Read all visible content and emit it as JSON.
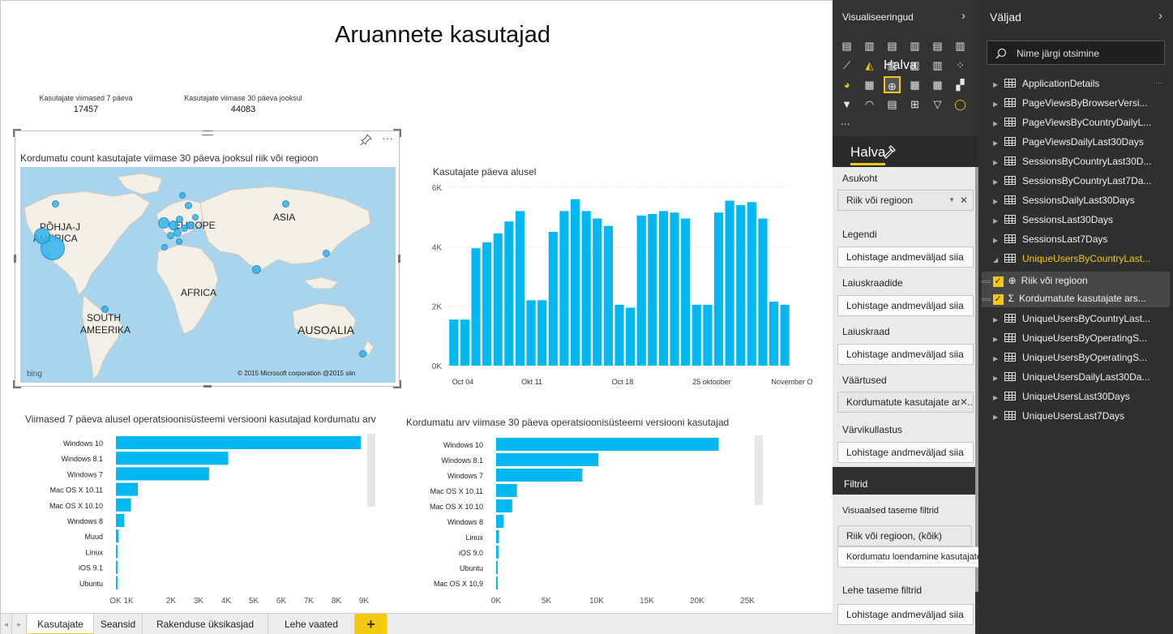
{
  "report": {
    "title": "Aruannete kasutajad",
    "cards": [
      {
        "label": "Kasutajate viimased 7 päeva",
        "value": "17457"
      },
      {
        "label": "Kasutajate viimase 30 päeva jooksul",
        "value": "44083"
      }
    ]
  },
  "map": {
    "title": "Kordumatu count kasutajate viimase 30 päeva jooksul riik või regioon",
    "labels": {
      "north_america_1": "PÕHJA-J",
      "north_america_2": "AMERICA",
      "europe": "EUROPE",
      "asia": "ASIA",
      "africa": "AFRICA",
      "south_america_1": "SOUTH",
      "south_america_2": "AMEERIKA",
      "australia": "AUSOALIA"
    },
    "copyright": "© 2015 Microsoft corporation @2015 siin",
    "brand": "bing",
    "pin_icon": "pin-icon",
    "more_icon": "more-options-icon"
  },
  "daily_chart_title": "Kasutajate päeva alusel",
  "os7_title": "Viimased 7 päeva alusel operatsioonisüsteemi versiooni kasutajad kordumatu arv",
  "os30_title": "Kordumatu arv viimase 30 päeva operatsioonisüsteemi versiooni kasutajad",
  "chart_data": [
    {
      "type": "bar",
      "title": "Kasutajate päeva alusel",
      "ylim": [
        0,
        6000
      ],
      "y_ticks": [
        "0K",
        "2K",
        "4K",
        "6K"
      ],
      "x_tick_labels": [
        "Oct 04",
        "Okt 11",
        "Oct 18",
        "25 oktoober",
        "November O"
      ],
      "values": [
        1550,
        1550,
        3950,
        4150,
        4450,
        4850,
        5200,
        2200,
        2200,
        4500,
        5200,
        5600,
        5200,
        4950,
        4700,
        2050,
        1950,
        5050,
        5100,
        5200,
        5150,
        4950,
        2050,
        2050,
        5150,
        5550,
        5400,
        5500,
        4950,
        2150,
        2050
      ],
      "color": "#01b8f2",
      "grid": true
    },
    {
      "type": "bar",
      "orientation": "horizontal",
      "title": "Viimased 7 päeva alusel operatsioonisüsteemi versiooni kasutajad kordumatu arv",
      "categories": [
        "Windows 10",
        "Windows 8.1",
        "Windows 7",
        "Mac OS X 10.11",
        "Mac OS X 10.10",
        "Windows 8",
        "Muud",
        "Linux",
        "iOS 9.1",
        "Ubuntu"
      ],
      "values": [
        8950,
        4100,
        3400,
        800,
        550,
        300,
        100,
        60,
        40,
        30
      ],
      "x_tick_labels": [
        "OK 1K",
        "2K",
        "3K",
        "4K",
        "5K",
        "6K",
        "7K",
        "8K",
        "9K"
      ],
      "xlim": [
        0,
        9000
      ],
      "color": "#01b8f2"
    },
    {
      "type": "bar",
      "orientation": "horizontal",
      "title": "Kordumatu arv viimase 30 päeva operatsioonisüsteemi versiooni kasutajad",
      "categories": [
        "Windows 10",
        "Windows 8.1",
        "Windows 7",
        "Mac OS X 10.11",
        "Mac OS X 10.10",
        "Windows 8",
        "Linux",
        "iOS 9.0",
        "Ubuntu",
        "Mac OS X 10,9"
      ],
      "values": [
        23500,
        10800,
        9100,
        2200,
        1700,
        800,
        300,
        250,
        150,
        100
      ],
      "x_tick_labels": [
        "0K",
        "5K",
        "10K",
        "15K",
        "20K",
        "25K"
      ],
      "xlim": [
        0,
        25000
      ],
      "color": "#01b8f2"
    }
  ],
  "tabs": [
    "Kasutajate",
    "Seansid",
    "Rakenduse üksikasjad",
    "Lehe vaated"
  ],
  "tabs_add": "+",
  "viz_pane": {
    "title": "Visualiseeringud",
    "hover_label": "Halva",
    "format_tab": "Halva",
    "sections": {
      "location": "Asukoht",
      "legend": "Legendi",
      "latitude": "Laiuskraadide",
      "longitude": "Laiuskraad",
      "values": "Väärtused",
      "saturation": "Värvikullastus",
      "filters": "Filtrid",
      "visual_filters": "Visuaalsed taseme filtrid",
      "page_filters": "Lehe taseme filtrid"
    },
    "wells": {
      "location": "Riik või regioon",
      "legend": "Lohistage andmeväljad siia",
      "latitude": "Lohistage andmeväljad siia",
      "longitude": "Lohistage andmeväljad siia",
      "values": "Kordumatute kasutajate arv...",
      "saturation": "Lohistage andmeväljad siia",
      "filter1": "Riik või regioon, (kõik)",
      "filter2": "Kordumatu loendamine kasutajate viimati...",
      "page_filter": "Lohistage andmeväljad siia"
    },
    "more": "..."
  },
  "fields_pane": {
    "title": "Väljad",
    "search_placeholder": "Nime järgi otsimine",
    "tables": [
      "ApplicationDetails",
      "PageViewsByBrowserVersi...",
      "PageViewsByCountryDailyL...",
      "PageViewsDailyLast30Days",
      "SessionsByCountryLast30D...",
      "SessionsByCountryLast7Da...",
      "SessionsDailyLast30Days",
      "SessionsLast30Days",
      "SessionsLast7Days",
      "UniqueUsersByCountryLast..."
    ],
    "expanded_fields": [
      "Riik või regioon",
      "Kordumatute kasutajate ars..."
    ],
    "tables_after": [
      "UniqueUsersByCountryLast...",
      "UniqueUsersByOperatingS...",
      "UniqueUsersByOperatingS...",
      "UniqueUsersDailyLast30Da...",
      "UniqueUsersLast30Days",
      "UniqueUsersLast7Days"
    ],
    "more": "..."
  },
  "colors": {
    "accent": "#f2c811",
    "bar": "#01b8f2",
    "pane_dark": "#333333"
  }
}
